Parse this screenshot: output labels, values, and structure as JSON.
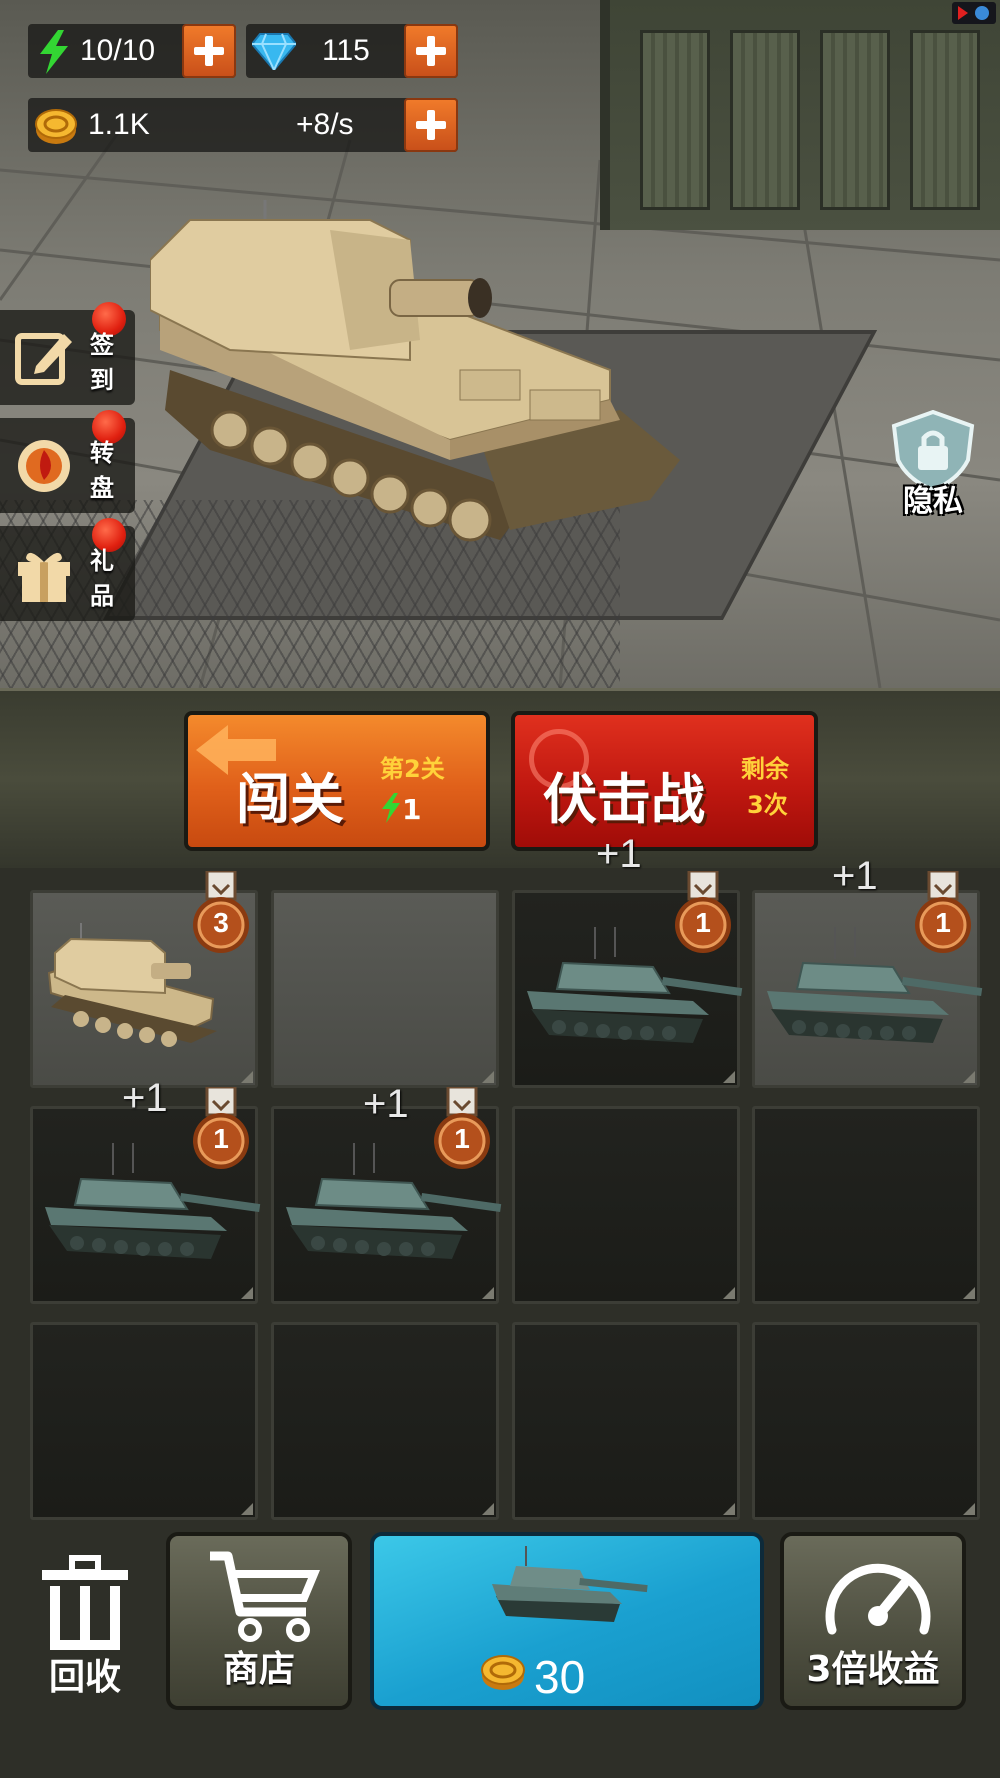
{
  "resources": {
    "energy": "10/10",
    "diamonds": "115",
    "coins": "1.1K",
    "coin_rate": "+8/s"
  },
  "side_menu": [
    {
      "label": "签到",
      "icon": "sign-in-icon"
    },
    {
      "label": "转盘",
      "icon": "wheel-icon"
    },
    {
      "label": "礼品",
      "icon": "gift-icon"
    }
  ],
  "privacy": {
    "label": "隐私",
    "icon": "lock-shield-icon"
  },
  "modes": {
    "stage": {
      "title": "闯关",
      "level": "第2关",
      "cost": "1"
    },
    "ambush": {
      "title": "伏击战",
      "remaining_line1": "剩余",
      "remaining_line2": "3次"
    }
  },
  "grid": {
    "slots": [
      {
        "tank": "spg",
        "level": "3",
        "bg": "light",
        "plus": ""
      },
      {
        "tank": "",
        "level": "",
        "bg": "light",
        "plus": ""
      },
      {
        "tank": "medium",
        "level": "1",
        "bg": "dark",
        "plus": "+1"
      },
      {
        "tank": "medium",
        "level": "1",
        "bg": "light",
        "plus": "+1"
      },
      {
        "tank": "medium",
        "level": "1",
        "bg": "dark",
        "plus": "+1"
      },
      {
        "tank": "medium",
        "level": "1",
        "bg": "dark",
        "plus": "+1"
      },
      {
        "tank": "",
        "level": "",
        "bg": "dark",
        "plus": ""
      },
      {
        "tank": "",
        "level": "",
        "bg": "dark",
        "plus": ""
      },
      {
        "tank": "",
        "level": "",
        "bg": "dark",
        "plus": ""
      },
      {
        "tank": "",
        "level": "",
        "bg": "dark",
        "plus": ""
      },
      {
        "tank": "",
        "level": "",
        "bg": "dark",
        "plus": ""
      },
      {
        "tank": "",
        "level": "",
        "bg": "dark",
        "plus": ""
      }
    ]
  },
  "bottom": {
    "recycle_label": "回收",
    "shop_label": "商店",
    "buy_price": "30",
    "boost_label": "3倍收益"
  },
  "colors": {
    "orange_button": "#e0601a",
    "red_button": "#c01810",
    "cyan_button": "#1aa0d0",
    "medal_bronze": "#b4501c"
  }
}
